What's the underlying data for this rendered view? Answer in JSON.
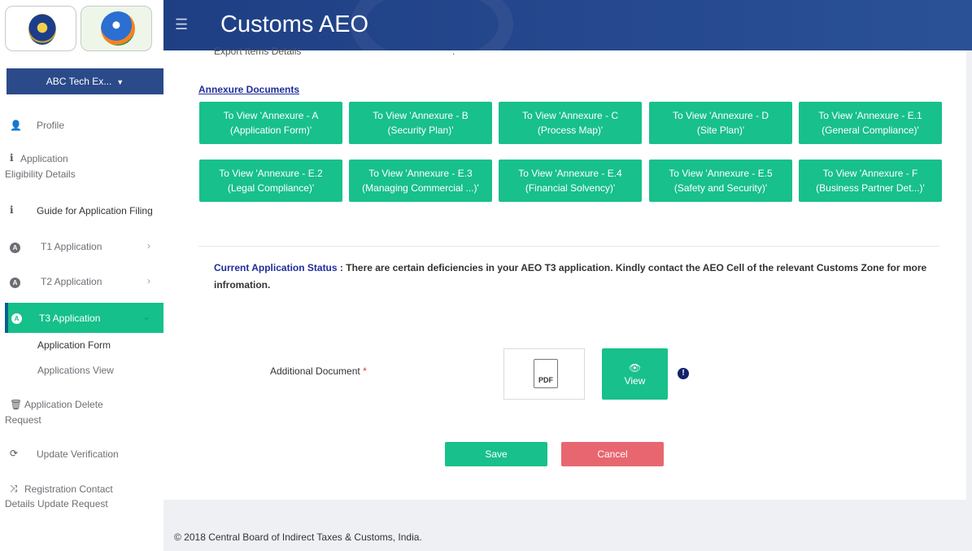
{
  "header": {
    "title": "Customs AEO"
  },
  "sidebar": {
    "company": "ABC Tech Ex...",
    "items": [
      {
        "label": "Profile"
      },
      {
        "label": "Application",
        "label2": "Eligibility Details"
      },
      {
        "label": "Guide for Application Filing"
      },
      {
        "label": "T1 Application"
      },
      {
        "label": "T2 Application"
      },
      {
        "label": "T3 Application"
      },
      {
        "label": "Application Delete",
        "label2": "Request"
      },
      {
        "label": "Update Verification"
      },
      {
        "label": "Registration Contact",
        "label2": "Details Update Request"
      }
    ],
    "subitems": [
      "Application Form",
      "Applications View"
    ]
  },
  "main": {
    "cut_label": "Export Items Details",
    "cut_colon": ":",
    "annexure_title": "Annexure Documents",
    "annexures": [
      {
        "line1": "To View 'Annexure - A",
        "line2": "(Application Form)'"
      },
      {
        "line1": "To View 'Annexure - B",
        "line2": "(Security Plan)'"
      },
      {
        "line1": "To View 'Annexure - C",
        "line2": "(Process Map)'"
      },
      {
        "line1": "To View 'Annexure - D",
        "line2": "(Site Plan)'"
      },
      {
        "line1": "To View 'Annexure - E.1",
        "line2": "(General Compliance)'"
      },
      {
        "line1": "To View 'Annexure - E.2",
        "line2": "(Legal Compliance)'"
      },
      {
        "line1": "To View 'Annexure - E.3",
        "line2": "(Managing Commercial ...)'"
      },
      {
        "line1": "To View 'Annexure - E.4",
        "line2": "(Financial Solvency)'"
      },
      {
        "line1": "To View 'Annexure - E.5",
        "line2": "(Safety and Security)'"
      },
      {
        "line1": "To View 'Annexure - F",
        "line2": "(Business Partner Det...)'"
      }
    ],
    "status_key": "Current Application Status",
    "status_sep": " : ",
    "status_text": "There are certain deficiencies in your AEO T3 application. Kindly contact the AEO Cell of the relevant Customs Zone for more infromation.",
    "additional_doc_label": "Additional Document",
    "required_mark": "*",
    "pdf_label": "PDF",
    "view_label": "View",
    "info_glyph": "!",
    "save_label": "Save",
    "cancel_label": "Cancel"
  },
  "footer": {
    "text": "© 2018 Central Board of Indirect Taxes & Customs, India."
  },
  "colors": {
    "accent": "#18c08b",
    "header": "#26498f",
    "cancel": "#e8666f",
    "link": "#1f2d9a"
  },
  "icons": {
    "menu": "hamburger-icon",
    "profile": "user-icon",
    "info": "info-icon",
    "app": "a-circle-icon",
    "trash": "trash-icon",
    "refresh": "refresh-icon",
    "shuffle": "shuffle-icon",
    "eye": "eye-icon"
  }
}
